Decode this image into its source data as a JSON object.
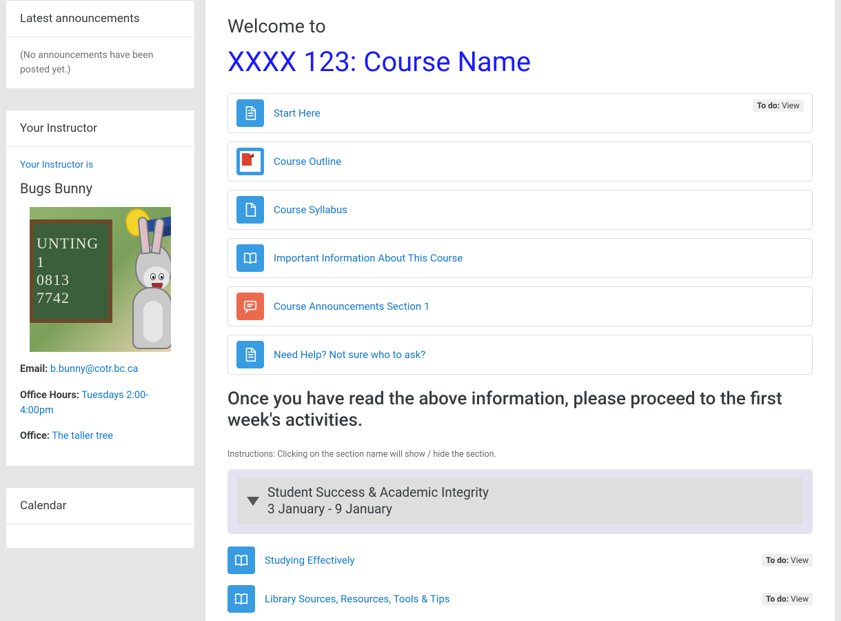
{
  "sidebar": {
    "announcements": {
      "title": "Latest announcements",
      "empty": "(No announcements have been posted yet.)"
    },
    "instructor": {
      "title": "Your Instructor",
      "intro": "Your Instructor is",
      "name": "Bugs Bunny",
      "chalk_line1": "UNTING 1",
      "chalk_line2": "0813",
      "chalk_line3": "7742",
      "email_label": "Email:",
      "email": "b.bunny@cotr.bc.ca",
      "hours_label": "Office Hours:",
      "hours": "Tuesdays 2:00-4:00pm",
      "office_label": "Office:",
      "office": "The taller tree"
    },
    "calendar": {
      "title": "Calendar"
    }
  },
  "main": {
    "welcome_pre": "Welcome to",
    "course_title": "XXXX 123: Course Name",
    "activities": [
      {
        "icon": "doc",
        "color": "blue",
        "label": "Start Here",
        "todo": "View"
      },
      {
        "icon": "pdf",
        "color": "blue",
        "label": "Course Outline"
      },
      {
        "icon": "file",
        "color": "blue",
        "label": "Course Syllabus"
      },
      {
        "icon": "book",
        "color": "blue",
        "label": "Important Information About This Course"
      },
      {
        "icon": "chat",
        "color": "red",
        "label": "Course Announcements Section 1"
      },
      {
        "icon": "doc",
        "color": "blue",
        "label": "Need Help? Not sure who to ask?"
      }
    ],
    "proceed_note": "Once you have read the above information, please proceed to the first week's activities.",
    "instructions": "Instructions: Clicking on the section name will show / hide the section.",
    "week": {
      "line1": "Student Success & Academic Integrity",
      "line2": "3 January - 9 January"
    },
    "week_items": [
      {
        "icon": "book",
        "label": "Studying Effectively",
        "todo": "View"
      },
      {
        "icon": "book",
        "label": "Library Sources, Resources, Tools & Tips",
        "todo": "View"
      }
    ],
    "todo_label": "To do:"
  }
}
